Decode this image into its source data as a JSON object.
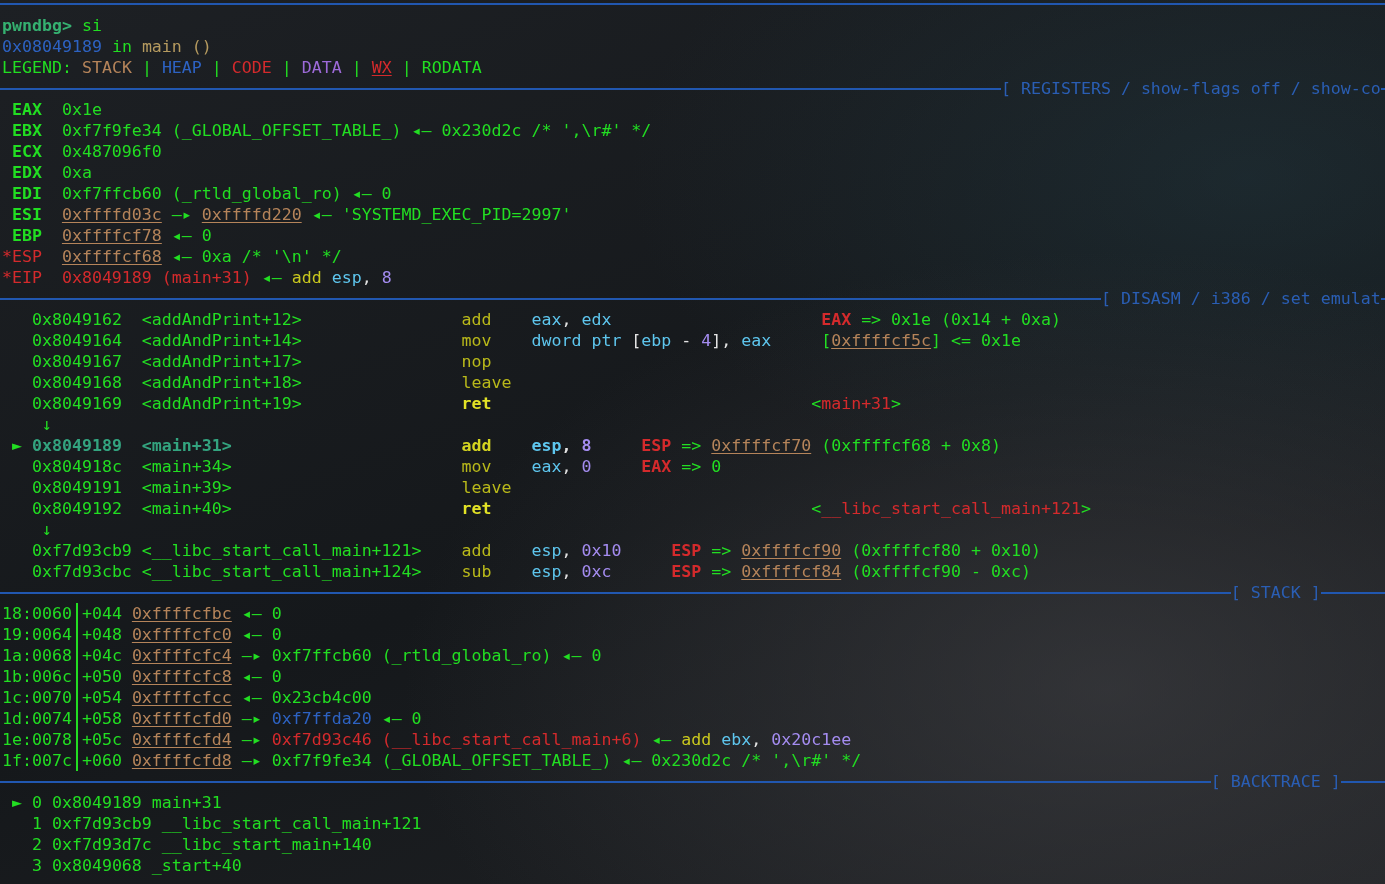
{
  "command": {
    "prompt": "pwndbg>",
    "input": "si"
  },
  "stop_location": [
    {
      "text": "0x08049189",
      "kind": "heap"
    },
    {
      "text": " in ",
      "kind": "plain"
    },
    {
      "text": "main ()",
      "kind": "symbol"
    }
  ],
  "legend": [
    {
      "text": "LEGEND: ",
      "kind": "plain"
    },
    {
      "text": "STACK",
      "kind": "stack"
    },
    {
      "text": " | ",
      "kind": "plain"
    },
    {
      "text": "HEAP",
      "kind": "heap"
    },
    {
      "text": " | ",
      "kind": "plain"
    },
    {
      "text": "CODE",
      "kind": "code"
    },
    {
      "text": " | ",
      "kind": "plain"
    },
    {
      "text": "DATA",
      "kind": "data"
    },
    {
      "text": " | ",
      "kind": "plain"
    },
    {
      "text": "WX",
      "kind": "wx"
    },
    {
      "text": " | ",
      "kind": "plain"
    },
    {
      "text": "RODATA",
      "kind": "rodata"
    }
  ],
  "registers": {
    "title": "[ REGISTERS / show-flags off / show-co",
    "rows": [
      {
        "name": "EAX",
        "changed": false,
        "value": [
          {
            "text": "0x1e",
            "kind": "plain"
          }
        ]
      },
      {
        "name": "EBX",
        "changed": false,
        "value": [
          {
            "text": "0xf7f9fe34 (_GLOBAL_OFFSET_TABLE_) ◂— 0x230d2c /* ',\\r#' */",
            "kind": "plain"
          }
        ]
      },
      {
        "name": "ECX",
        "changed": false,
        "value": [
          {
            "text": "0x487096f0",
            "kind": "plain"
          }
        ]
      },
      {
        "name": "EDX",
        "changed": false,
        "value": [
          {
            "text": "0xa",
            "kind": "plain"
          }
        ]
      },
      {
        "name": "EDI",
        "changed": false,
        "value": [
          {
            "text": "0xf7ffcb60 (_rtld_global_ro) ◂— 0",
            "kind": "plain"
          }
        ]
      },
      {
        "name": "ESI",
        "changed": false,
        "value": [
          {
            "text": "0xffffd03c",
            "kind": "pointer"
          },
          {
            "text": " —▸ ",
            "kind": "plain"
          },
          {
            "text": "0xffffd220",
            "kind": "pointer"
          },
          {
            "text": " ◂— 'SYSTEMD_EXEC_PID=2997'",
            "kind": "plain"
          }
        ]
      },
      {
        "name": "EBP",
        "changed": false,
        "value": [
          {
            "text": "0xffffcf78",
            "kind": "pointer"
          },
          {
            "text": " ◂— 0",
            "kind": "plain"
          }
        ]
      },
      {
        "name": "*ESP",
        "changed": true,
        "value": [
          {
            "text": "0xffffcf68",
            "kind": "pointer"
          },
          {
            "text": " ◂— 0xa /* '\\n' */",
            "kind": "plain"
          }
        ]
      },
      {
        "name": "*EIP",
        "changed": true,
        "value": [
          {
            "text": "0x8049189 (main+31)",
            "kind": "code"
          },
          {
            "text": " ◂— ",
            "kind": "plain"
          },
          {
            "text": "add ",
            "kind": "mnemonic"
          },
          {
            "text": "esp",
            "kind": "register"
          },
          {
            "text": ", ",
            "kind": "punct"
          },
          {
            "text": "8",
            "kind": "immediate"
          }
        ]
      }
    ]
  },
  "disasm": {
    "title": "[ DISASM / i386 / set emulat",
    "lines": [
      {
        "kind": "instruction",
        "current": false,
        "branch": false,
        "address": "0x8049162",
        "symbol": "<addAndPrint+12>",
        "mnemonic": "add",
        "operands": [
          {
            "text": "eax",
            "kind": "register"
          },
          {
            "text": ", ",
            "kind": "punct"
          },
          {
            "text": "edx",
            "kind": "register"
          }
        ],
        "annotation": {
          "kind": "effect",
          "parts": [
            {
              "text": "EAX",
              "kind": "dest"
            },
            {
              "text": " => 0x1e (0x14 + 0xa)",
              "kind": "plain"
            }
          ]
        }
      },
      {
        "kind": "instruction",
        "current": false,
        "branch": false,
        "address": "0x8049164",
        "symbol": "<addAndPrint+14>",
        "mnemonic": "mov",
        "operands": [
          {
            "text": "dword ptr ",
            "kind": "register"
          },
          {
            "text": "[",
            "kind": "punct"
          },
          {
            "text": "ebp",
            "kind": "register"
          },
          {
            "text": " - ",
            "kind": "punct"
          },
          {
            "text": "4",
            "kind": "immediate"
          },
          {
            "text": "], ",
            "kind": "punct"
          },
          {
            "text": "eax",
            "kind": "register"
          }
        ],
        "annotation": {
          "kind": "effect",
          "parts": [
            {
              "text": "[",
              "kind": "plain"
            },
            {
              "text": "0xffffcf5c",
              "kind": "pointer"
            },
            {
              "text": "] <= 0x1e",
              "kind": "plain"
            }
          ]
        }
      },
      {
        "kind": "instruction",
        "current": false,
        "branch": false,
        "address": "0x8049167",
        "symbol": "<addAndPrint+17>",
        "mnemonic": "nop"
      },
      {
        "kind": "instruction",
        "current": false,
        "branch": false,
        "address": "0x8049168",
        "symbol": "<addAndPrint+18>",
        "mnemonic": "leave"
      },
      {
        "kind": "instruction",
        "current": false,
        "branch": true,
        "address": "0x8049169",
        "symbol": "<addAndPrint+19>",
        "mnemonic": "ret",
        "annotation": {
          "kind": "target",
          "parts": [
            {
              "text": "<",
              "kind": "plain"
            },
            {
              "text": "main+31",
              "kind": "code"
            },
            {
              "text": ">",
              "kind": "plain"
            }
          ]
        }
      },
      {
        "kind": "arrow",
        "text": "↓"
      },
      {
        "kind": "instruction",
        "marker": "►",
        "current": true,
        "branch": false,
        "address": "0x8049189",
        "symbol": "<main+31>",
        "mnemonic": "add",
        "operands": [
          {
            "text": "esp",
            "kind": "register"
          },
          {
            "text": ", ",
            "kind": "punct"
          },
          {
            "text": "8",
            "kind": "immediate"
          }
        ],
        "annotation": {
          "kind": "effect",
          "parts": [
            {
              "text": "ESP",
              "kind": "dest"
            },
            {
              "text": " => ",
              "kind": "plain"
            },
            {
              "text": "0xffffcf70",
              "kind": "pointer"
            },
            {
              "text": " (0xffffcf68 + 0x8)",
              "kind": "plain"
            }
          ]
        }
      },
      {
        "kind": "instruction",
        "current": false,
        "branch": false,
        "address": "0x804918c",
        "symbol": "<main+34>",
        "mnemonic": "mov",
        "operands": [
          {
            "text": "eax",
            "kind": "register"
          },
          {
            "text": ", ",
            "kind": "punct"
          },
          {
            "text": "0",
            "kind": "immediate"
          }
        ],
        "annotation": {
          "kind": "effect",
          "parts": [
            {
              "text": "EAX",
              "kind": "dest"
            },
            {
              "text": " => 0",
              "kind": "plain"
            }
          ]
        }
      },
      {
        "kind": "instruction",
        "current": false,
        "branch": false,
        "address": "0x8049191",
        "symbol": "<main+39>",
        "mnemonic": "leave"
      },
      {
        "kind": "instruction",
        "current": false,
        "branch": true,
        "address": "0x8049192",
        "symbol": "<main+40>",
        "mnemonic": "ret",
        "annotation": {
          "kind": "target",
          "parts": [
            {
              "text": "<",
              "kind": "plain"
            },
            {
              "text": "__libc_start_call_main+121",
              "kind": "code"
            },
            {
              "text": ">",
              "kind": "plain"
            }
          ]
        }
      },
      {
        "kind": "arrow",
        "text": "↓"
      },
      {
        "kind": "instruction",
        "current": false,
        "branch": false,
        "address": "0xf7d93cb9",
        "symbol": "<__libc_start_call_main+121>",
        "mnemonic": "add",
        "operands": [
          {
            "text": "esp",
            "kind": "register"
          },
          {
            "text": ", ",
            "kind": "punct"
          },
          {
            "text": "0x10",
            "kind": "immediate"
          }
        ],
        "annotation": {
          "kind": "effect",
          "parts": [
            {
              "text": "ESP",
              "kind": "dest"
            },
            {
              "text": " => ",
              "kind": "plain"
            },
            {
              "text": "0xffffcf90",
              "kind": "pointer"
            },
            {
              "text": " (0xffffcf80 + 0x10)",
              "kind": "plain"
            }
          ]
        }
      },
      {
        "kind": "instruction",
        "current": false,
        "branch": false,
        "address": "0xf7d93cbc",
        "symbol": "<__libc_start_call_main+124>",
        "mnemonic": "sub",
        "operands": [
          {
            "text": "esp",
            "kind": "register"
          },
          {
            "text": ", ",
            "kind": "punct"
          },
          {
            "text": "0xc",
            "kind": "immediate"
          }
        ],
        "annotation": {
          "kind": "effect",
          "parts": [
            {
              "text": "ESP",
              "kind": "dest"
            },
            {
              "text": " => ",
              "kind": "plain"
            },
            {
              "text": "0xffffcf84",
              "kind": "pointer"
            },
            {
              "text": " (0xffffcf90 - 0xc)",
              "kind": "plain"
            }
          ]
        }
      }
    ]
  },
  "stack": {
    "title": "[ STACK ]",
    "rows": [
      {
        "slot": "18:0060",
        "offset": "+044",
        "address": "0xffffcfbc",
        "value": [
          {
            "text": "◂— 0",
            "kind": "plain"
          }
        ]
      },
      {
        "slot": "19:0064",
        "offset": "+048",
        "address": "0xffffcfc0",
        "value": [
          {
            "text": "◂— 0",
            "kind": "plain"
          }
        ]
      },
      {
        "slot": "1a:0068",
        "offset": "+04c",
        "address": "0xffffcfc4",
        "value": [
          {
            "text": "—▸ 0xf7ffcb60 (_rtld_global_ro) ◂— 0",
            "kind": "plain"
          }
        ]
      },
      {
        "slot": "1b:006c",
        "offset": "+050",
        "address": "0xffffcfc8",
        "value": [
          {
            "text": "◂— 0",
            "kind": "plain"
          }
        ]
      },
      {
        "slot": "1c:0070",
        "offset": "+054",
        "address": "0xffffcfcc",
        "value": [
          {
            "text": "◂— 0x23cb4c00",
            "kind": "plain"
          }
        ]
      },
      {
        "slot": "1d:0074",
        "offset": "+058",
        "address": "0xffffcfd0",
        "value": [
          {
            "text": "—▸ ",
            "kind": "plain"
          },
          {
            "text": "0xf7ffda20",
            "kind": "heap"
          },
          {
            "text": " ◂— 0",
            "kind": "plain"
          }
        ]
      },
      {
        "slot": "1e:0078",
        "offset": "+05c",
        "address": "0xffffcfd4",
        "value": [
          {
            "text": "—▸ ",
            "kind": "plain"
          },
          {
            "text": "0xf7d93c46 (__libc_start_call_main+6)",
            "kind": "code"
          },
          {
            "text": " ◂— ",
            "kind": "plain"
          },
          {
            "text": "add ",
            "kind": "mnemonic"
          },
          {
            "text": "ebx",
            "kind": "register"
          },
          {
            "text": ", ",
            "kind": "punct"
          },
          {
            "text": "0x20c1ee",
            "kind": "immediate"
          }
        ]
      },
      {
        "slot": "1f:007c",
        "offset": "+060",
        "address": "0xffffcfd8",
        "value": [
          {
            "text": "—▸ 0xf7f9fe34 (_GLOBAL_OFFSET_TABLE_) ◂— 0x230d2c /* ',\\r#' */",
            "kind": "plain"
          }
        ]
      }
    ]
  },
  "backtrace": {
    "title": "[ BACKTRACE ]",
    "frames": [
      {
        "marker": "►",
        "index": "0",
        "address": "0x8049189",
        "symbol": "main+31"
      },
      {
        "index": "1",
        "address": "0xf7d93cb9",
        "symbol": "__libc_start_call_main+121"
      },
      {
        "index": "2",
        "address": "0xf7d93d7c",
        "symbol": "__libc_start_main+140"
      },
      {
        "index": "3",
        "address": "0x8049068",
        "symbol": "_start+40"
      }
    ]
  }
}
